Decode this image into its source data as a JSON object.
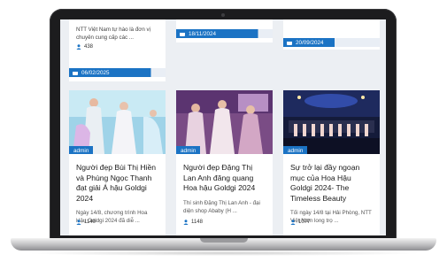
{
  "top_left": {
    "snippet": [
      "NTT Việt Nam tự hào là đơn vị",
      "chuyên cung cấp các ..."
    ],
    "views": "438",
    "date": "06/02/2025"
  },
  "top_middle": {
    "date": "18/11/2024"
  },
  "top_right": {
    "date": "20/09/2024"
  },
  "cards": [
    {
      "badge": "admin",
      "title": "Người đẹp Bùi Thị Hiền và Phùng Ngọc Thanh đạt giải Á hậu Goldgi 2024",
      "excerpt": "Ngày 14/8, chương trình Hoa Hậu Goldgi 2024 đã diễ ...",
      "views": "1140"
    },
    {
      "badge": "admin",
      "title": "Người đẹp Đặng Thị Lan Anh đăng quang Hoa hậu Goldgi 2024",
      "excerpt": "Thí sinh Đặng Thị Lan Anh - đại diện shop Ababy (H ...",
      "views": "1148"
    },
    {
      "badge": "admin",
      "title": "Sự trở lại đầy ngoạn mục của Hoa Hậu Goldgi 2024- The Timeless Beauty",
      "excerpt": "Tối ngày 14/8 tại Hải Phòng, NTT Việt Nam long trọ ...",
      "views": "1077"
    }
  ],
  "colors": {
    "accent": "#1b73c4",
    "laptop_bezel": "#1c1c1e",
    "page_bg": "#eceff3"
  }
}
